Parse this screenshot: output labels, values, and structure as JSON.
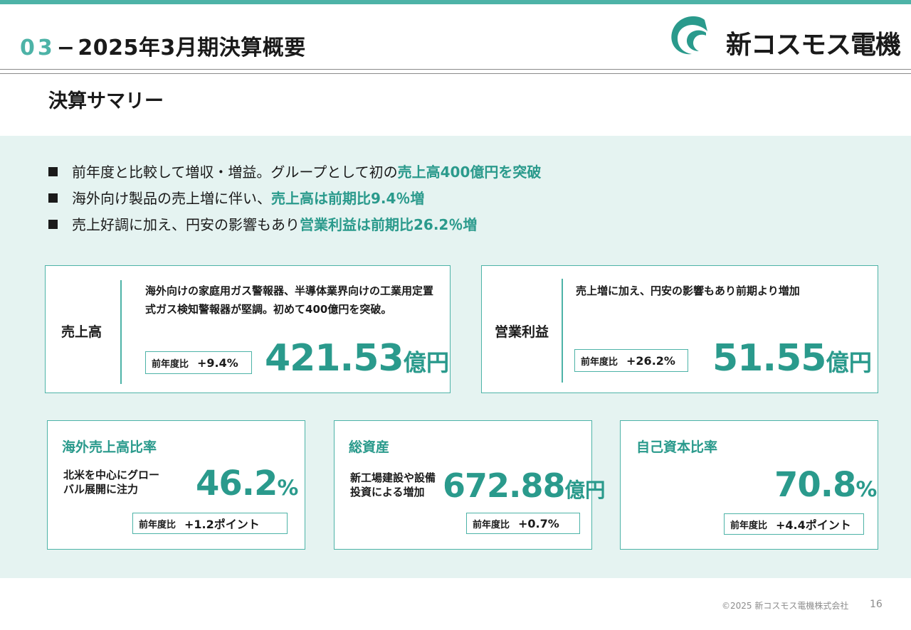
{
  "header": {
    "section_number": "03",
    "separator": "−",
    "title": "2025年3月期決算概要"
  },
  "logo": {
    "company_name": "新コスモス電機"
  },
  "section_title": "決算サマリー",
  "bullets": [
    {
      "text": "前年度と比較して増収・増益。グループとして初の",
      "highlight": "売上高400億円を突破"
    },
    {
      "text": "海外向け製品の売上増に伴い、",
      "highlight": "売上高は前期比9.4％増"
    },
    {
      "text": "売上好調に加え、円安の影響もあり",
      "highlight": "営業利益は前期比26.2％増"
    }
  ],
  "cards": {
    "sales": {
      "label": "売上高",
      "description": "海外向けの家庭用ガス警報器、半導体業界向けの工業用定置式ガス検知警報器が堅調。初めて400億円を突破。",
      "yoy_label": "前年度比",
      "yoy_value": "+9.4%",
      "value": "421.53",
      "unit": "億円"
    },
    "operating_profit": {
      "label": "営業利益",
      "description": "売上増に加え、円安の影響もあり前期より増加",
      "yoy_label": "前年度比",
      "yoy_value": "+26.2%",
      "value": "51.55",
      "unit": "億円"
    },
    "overseas_ratio": {
      "title": "海外売上高比率",
      "description": "北米を中心にグローバル展開に注力",
      "value": "46.2",
      "unit": "%",
      "yoy_label": "前年度比",
      "yoy_value": "+1.2ポイント"
    },
    "total_assets": {
      "title": "総資産",
      "description": "新工場建設や設備投資による増加",
      "value": "672.88",
      "unit": "億円",
      "yoy_label": "前年度比",
      "yoy_value": "+0.7%"
    },
    "equity_ratio": {
      "title": "自己資本比率",
      "value": "70.8",
      "unit": "%",
      "yoy_label": "前年度比",
      "yoy_value": "+4.4ポイント"
    }
  },
  "footer": {
    "copyright": "©2025 新コスモス電機株式会社",
    "page_number": "16"
  },
  "colors": {
    "accent": "#4db3a7",
    "highlight_text": "#2a9a8c",
    "panel_bg": "#e5f3f1"
  }
}
